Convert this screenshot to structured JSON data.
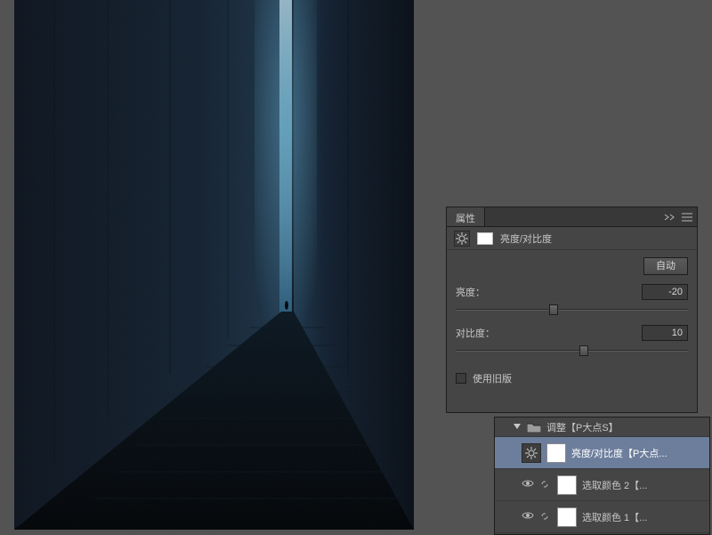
{
  "properties": {
    "tab_label": "属性",
    "adjustment_title": "亮度/对比度",
    "auto_button": "自动",
    "brightness_label": "亮度：",
    "brightness_value": "-20",
    "brightness_pos_pct": 42,
    "contrast_label": "对比度：",
    "contrast_value": "10",
    "contrast_pos_pct": 55,
    "legacy_label": "使用旧版"
  },
  "layers": {
    "group": {
      "name": "调整【P大点S】"
    },
    "items": [
      {
        "name": "亮度/对比度【P大点...",
        "selected": true,
        "type": "brightness"
      },
      {
        "name": "选取颜色 2【...",
        "selected": false,
        "type": "selective"
      },
      {
        "name": "选取颜色 1【...",
        "selected": false,
        "type": "selective"
      }
    ]
  }
}
